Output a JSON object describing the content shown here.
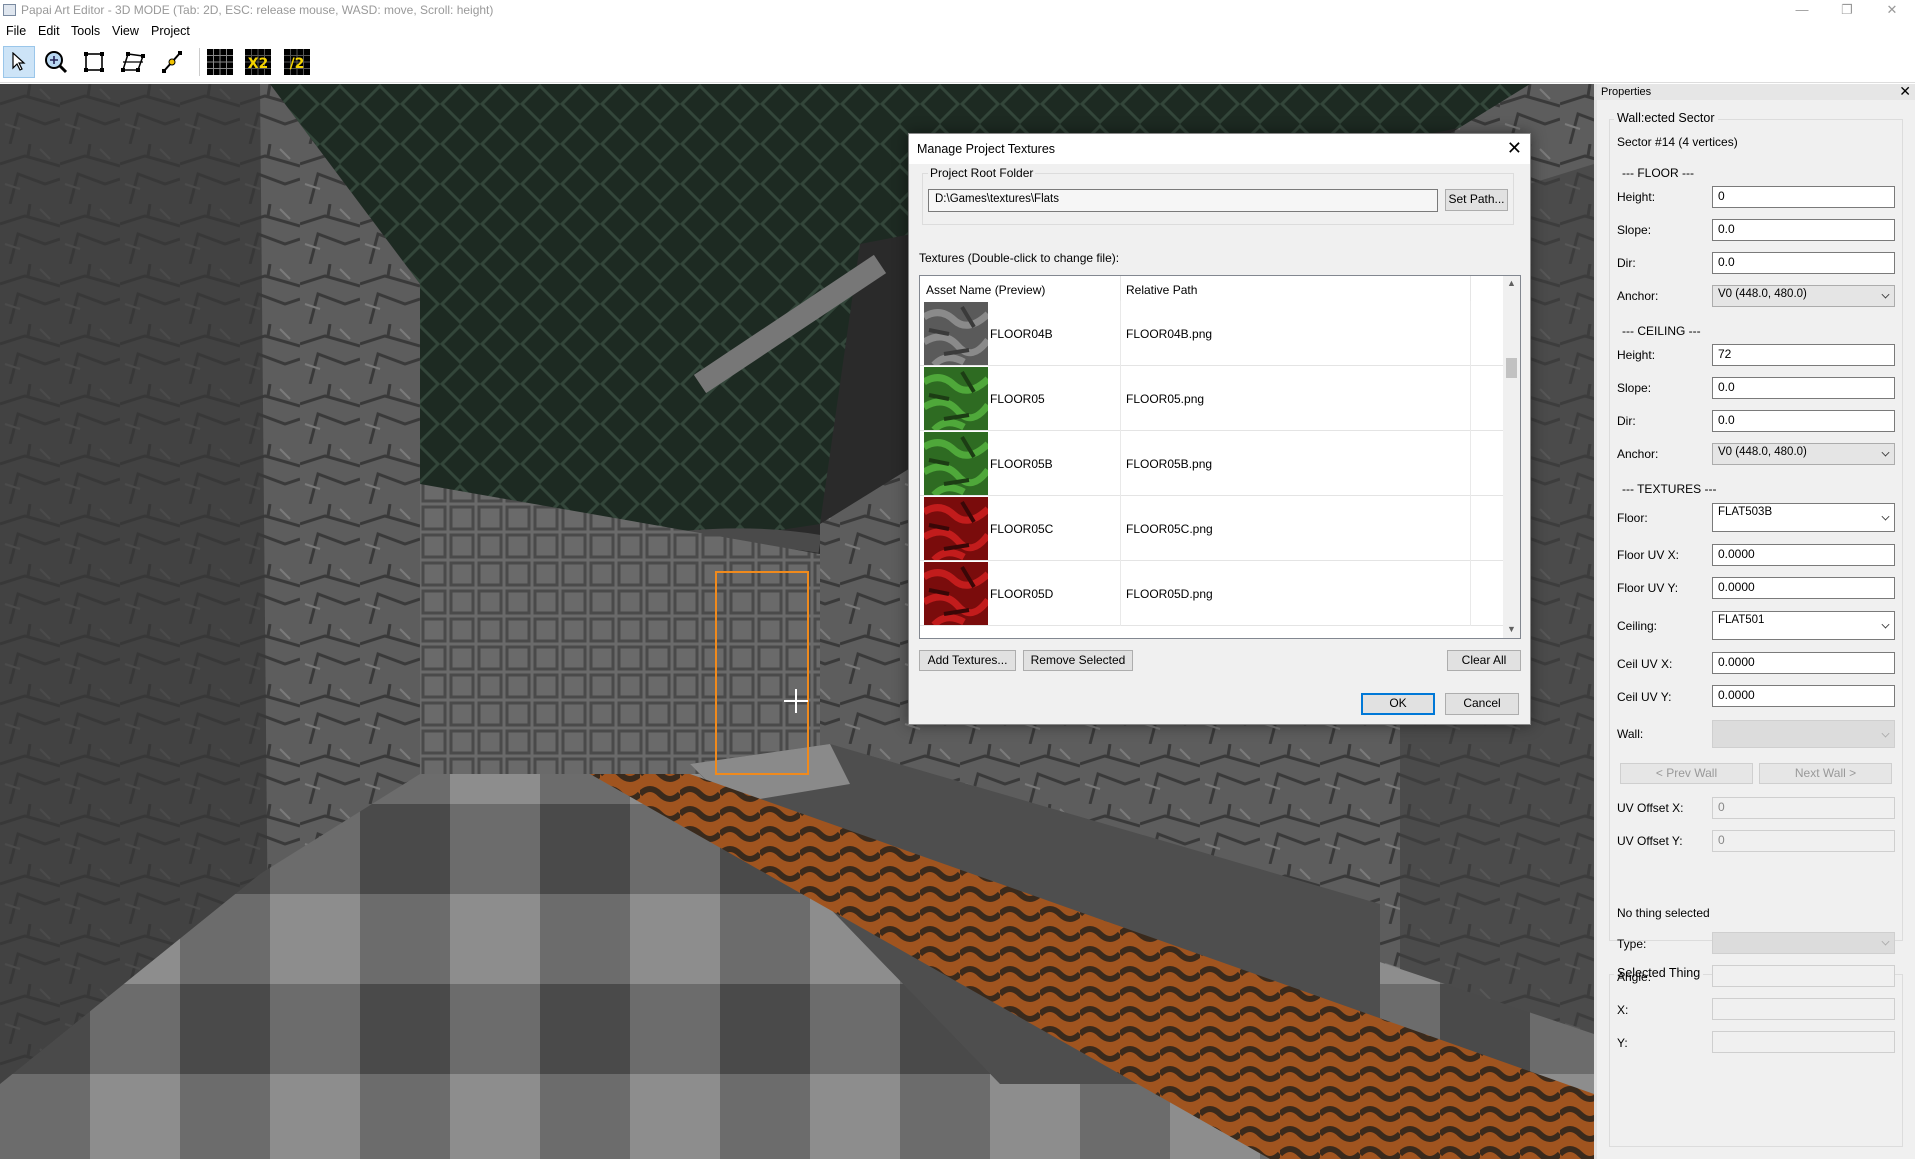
{
  "window": {
    "title": "Papai Art Editor - 3D MODE (Tab: 2D, ESC: release mouse, WASD: move, Scroll: height)"
  },
  "menu": [
    "File",
    "Edit",
    "Tools",
    "View",
    "Project"
  ],
  "toolbar": {
    "tools": [
      "select-tool",
      "zoom-tool",
      "rectangle-tool",
      "vertex-edit-tool",
      "line-tool"
    ],
    "grid": "grid-toggle",
    "grid_double_label": "X2",
    "grid_half_label": "/2"
  },
  "dialog": {
    "title": "Manage Project Textures",
    "root_group_label": "Project Root Folder",
    "root_path": "D:\\Games\\textures\\Flats",
    "set_path_label": "Set Path...",
    "textures_caption": "Textures (Double-click to change file):",
    "columns": [
      "Asset Name (Preview)",
      "Relative Path"
    ],
    "rows": [
      {
        "name": "FLOOR04B",
        "path": "FLOOR04B.png",
        "swatch": "gray"
      },
      {
        "name": "FLOOR05",
        "path": "FLOOR05.png",
        "swatch": "green"
      },
      {
        "name": "FLOOR05B",
        "path": "FLOOR05B.png",
        "swatch": "green"
      },
      {
        "name": "FLOOR05C",
        "path": "FLOOR05C.png",
        "swatch": "red"
      },
      {
        "name": "FLOOR05D",
        "path": "FLOOR05D.png",
        "swatch": "red"
      }
    ],
    "add_label": "Add Textures...",
    "remove_label": "Remove Selected",
    "clear_label": "Clear All",
    "ok_label": "OK",
    "cancel_label": "Cancel"
  },
  "properties": {
    "title": "Properties",
    "sector_group": "Wall:ected Sector",
    "sector_info": "Sector #14 (4 vertices)",
    "floor_heading": "--- FLOOR ---",
    "ceiling_heading": "--- CEILING ---",
    "textures_heading": "--- TEXTURES ---",
    "labels": {
      "height": "Height:",
      "slope": "Slope:",
      "dir": "Dir:",
      "anchor": "Anchor:",
      "floor": "Floor:",
      "floor_uv_x": "Floor UV X:",
      "floor_uv_y": "Floor UV Y:",
      "ceiling": "Ceiling:",
      "ceil_uv_x": "Ceil UV X:",
      "ceil_uv_y": "Ceil UV Y:",
      "wall": "Wall:",
      "uv_offset_x": "UV Offset X:",
      "uv_offset_y": "UV Offset Y:",
      "type": "Type:",
      "angle": "Angle:",
      "x": "X:",
      "y": "Y:"
    },
    "floor": {
      "height": "0",
      "slope": "0.0",
      "dir": "0.0",
      "anchor": "V0 (448.0, 480.0)"
    },
    "ceiling": {
      "height": "72",
      "slope": "0.0",
      "dir": "0.0",
      "anchor": "V0 (448.0, 480.0)"
    },
    "textures": {
      "floor": "FLAT503B",
      "floor_uv_x": "0.0000",
      "floor_uv_y": "0.0000",
      "ceiling": "FLAT501",
      "ceil_uv_x": "0.0000",
      "ceil_uv_y": "0.0000",
      "wall": ""
    },
    "prev_wall_label": "< Prev Wall",
    "next_wall_label": "Next Wall >",
    "uv_offset_x": "0",
    "uv_offset_y": "0",
    "thing_group": "Selected Thing",
    "thing_info": "No thing selected"
  },
  "colors": {
    "selection": "#f08a1c",
    "accent": "#0078d7"
  }
}
